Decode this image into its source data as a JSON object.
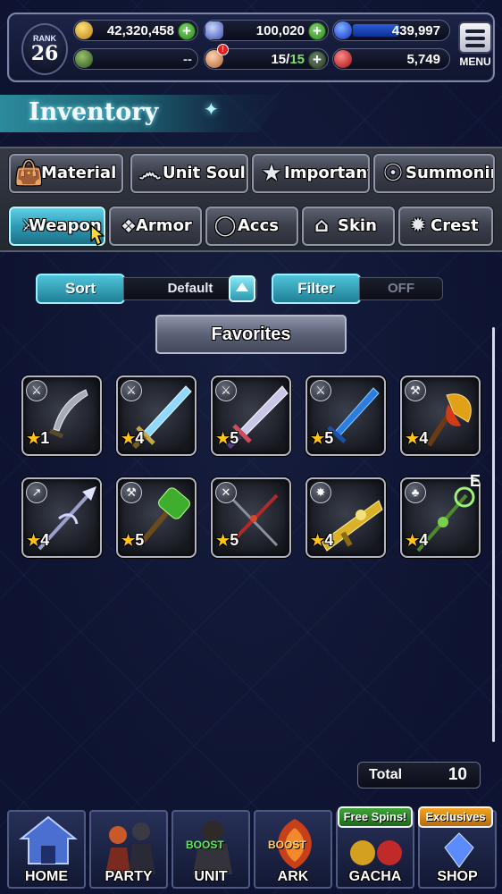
{
  "header": {
    "rank_label": "RANK",
    "rank_value": "26",
    "gold": "42,320,458",
    "crystals": "100,020",
    "orbs": "439,997",
    "compass": "--",
    "stamina_current": "15/",
    "stamina_max": "15",
    "rubies": "5,749",
    "menu_label": "MENU",
    "stamina_alert": "!"
  },
  "title": "Inventory",
  "tabs": {
    "row1": [
      {
        "label": "Material",
        "icon": "sack-icon"
      },
      {
        "label": "Unit Soul",
        "icon": "soul-flame-icon"
      },
      {
        "label": "Important",
        "icon": "star-icon"
      },
      {
        "label": "Summoning",
        "icon": "summon-helm-icon"
      }
    ],
    "row2": [
      {
        "label": "Weapon",
        "icon": "sword-icon",
        "active": true
      },
      {
        "label": "Armor",
        "icon": "armor-icon"
      },
      {
        "label": "Accs",
        "icon": "ring-icon"
      },
      {
        "label": "Skin",
        "icon": "hanger-icon"
      },
      {
        "label": "Crest",
        "icon": "crest-icon"
      }
    ]
  },
  "controls": {
    "sort_label": "Sort",
    "sort_value": "Default",
    "filter_label": "Filter",
    "filter_value": "OFF",
    "favorites_label": "Favorites"
  },
  "items": [
    {
      "type": "sword",
      "rarity": "1"
    },
    {
      "type": "sword",
      "rarity": "4"
    },
    {
      "type": "sword",
      "rarity": "5"
    },
    {
      "type": "sword",
      "rarity": "5"
    },
    {
      "type": "axe",
      "rarity": "4"
    },
    {
      "type": "spear",
      "rarity": "4"
    },
    {
      "type": "hammer",
      "rarity": "5"
    },
    {
      "type": "dual-blades",
      "rarity": "5"
    },
    {
      "type": "gun",
      "rarity": "4"
    },
    {
      "type": "staff",
      "rarity": "4"
    }
  ],
  "item_badge": "E",
  "total": {
    "label": "Total",
    "value": "10"
  },
  "nav": {
    "home": "HOME",
    "party": "PARTY",
    "unit": "UNIT",
    "ark": "ARK",
    "gacha": "GACHA",
    "shop": "SHOP",
    "unit_boost": "BOOST",
    "ark_boost": "BOOST",
    "gacha_tag": "Free Spins!",
    "shop_tag": "Exclusives"
  },
  "colors": {
    "active_tab": "#2e9bb5",
    "star": "#ffc31a",
    "plus_button": "#2f8a22",
    "stamina_max": "#7fe06a"
  }
}
